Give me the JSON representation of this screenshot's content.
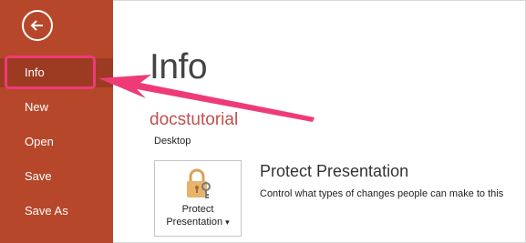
{
  "sidebar": {
    "items": [
      {
        "label": "Info"
      },
      {
        "label": "New"
      },
      {
        "label": "Open"
      },
      {
        "label": "Save"
      },
      {
        "label": "Save As"
      }
    ]
  },
  "main": {
    "title": "Info",
    "document_name": "docstutorial",
    "location": "Desktop",
    "protect_button": {
      "line1": "Protect",
      "line2": "Presentation",
      "dropdown_glyph": "▾"
    },
    "section_title": "Protect Presentation",
    "section_description": "Control what types of changes people can make to this"
  },
  "colors": {
    "sidebar": "#b7472a",
    "sidebar_active": "#9c3b22",
    "annotation": "#ee3b78",
    "document_name": "#c0504d"
  },
  "icons": [
    "back-arrow-icon",
    "lock-key-icon",
    "annotation-arrow"
  ]
}
